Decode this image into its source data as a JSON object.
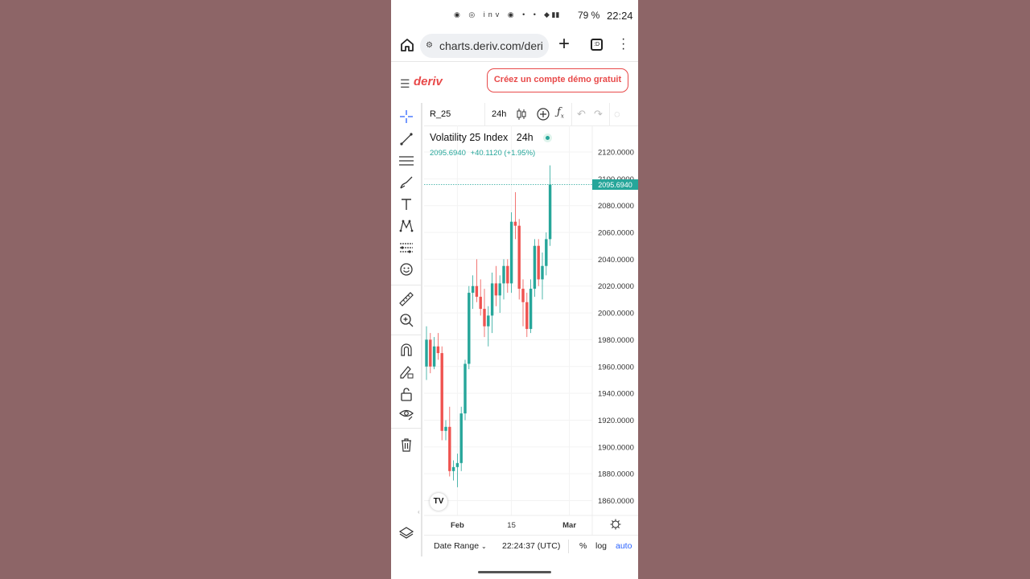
{
  "status_bar": {
    "notification_icons": "◉ ◎ inv ◉ • •",
    "signal": "◆ ▮▮",
    "battery": "79 %",
    "time": "22:24"
  },
  "browser": {
    "url": "charts.deriv.com/deri",
    "tab_count": ":D"
  },
  "app_header": {
    "logo": "deriv",
    "cta_label": "Créez un compte démo gratuit"
  },
  "chart_toolbar": {
    "symbol": "R_25",
    "timeframe": "24h"
  },
  "legend": {
    "title": "Volatility 25 Index",
    "timeframe": "24h",
    "last_price": "2095.6940",
    "change": "+40.1120 (+1.95%)"
  },
  "bottom_bar": {
    "date_range_label": "Date Range",
    "clock": "22:24:37 (UTC)",
    "percent_label": "%",
    "log_label": "log",
    "auto_label": "auto"
  },
  "colors": {
    "up": "#26a69a",
    "down": "#ef5350",
    "brand": "#e84a4a",
    "link": "#2962ff"
  },
  "icons": {
    "left_toolbar": [
      "crosshair-icon",
      "trend-line-icon",
      "horizontal-lines-icon",
      "brush-icon",
      "text-icon",
      "pattern-icon",
      "forecast-icon",
      "emoji-icon",
      "ruler-icon",
      "zoom-in-icon",
      "magnet-icon",
      "lock-drawings-icon",
      "unlock-icon",
      "eye-icon",
      "trash-icon",
      "layers-icon"
    ]
  },
  "chart_data": {
    "type": "candlestick",
    "ylim": [
      1850,
      2130
    ],
    "y_ticks": [
      "2120.0000",
      "2100.0000",
      "2080.0000",
      "2060.0000",
      "2040.0000",
      "2020.0000",
      "2000.0000",
      "1980.0000",
      "1960.0000",
      "1940.0000",
      "1920.0000",
      "1900.0000",
      "1880.0000",
      "1860.0000"
    ],
    "x_ticks": [
      {
        "label": "Feb",
        "index": 8
      },
      {
        "label": "15",
        "index": 22
      },
      {
        "label": "Mar",
        "index": 37
      }
    ],
    "price_line": 2095.694,
    "candles": [
      {
        "o": 1960,
        "h": 1990,
        "l": 1950,
        "c": 1980
      },
      {
        "o": 1980,
        "h": 1985,
        "l": 1955,
        "c": 1960
      },
      {
        "o": 1960,
        "h": 1982,
        "l": 1958,
        "c": 1975
      },
      {
        "o": 1975,
        "h": 1985,
        "l": 1965,
        "c": 1970
      },
      {
        "o": 1970,
        "h": 1975,
        "l": 1905,
        "c": 1912
      },
      {
        "o": 1912,
        "h": 1920,
        "l": 1905,
        "c": 1915
      },
      {
        "o": 1915,
        "h": 1930,
        "l": 1878,
        "c": 1882
      },
      {
        "o": 1882,
        "h": 1890,
        "l": 1875,
        "c": 1885
      },
      {
        "o": 1885,
        "h": 1895,
        "l": 1870,
        "c": 1888
      },
      {
        "o": 1888,
        "h": 1930,
        "l": 1882,
        "c": 1925
      },
      {
        "o": 1925,
        "h": 1965,
        "l": 1920,
        "c": 1962
      },
      {
        "o": 1962,
        "h": 2020,
        "l": 1958,
        "c": 2015
      },
      {
        "o": 2015,
        "h": 2028,
        "l": 2003,
        "c": 2020
      },
      {
        "o": 2020,
        "h": 2040,
        "l": 2008,
        "c": 2012
      },
      {
        "o": 2012,
        "h": 2025,
        "l": 1998,
        "c": 2003
      },
      {
        "o": 2003,
        "h": 2018,
        "l": 1982,
        "c": 1990
      },
      {
        "o": 1990,
        "h": 2005,
        "l": 1975,
        "c": 1998
      },
      {
        "o": 1998,
        "h": 2030,
        "l": 1985,
        "c": 2022
      },
      {
        "o": 2022,
        "h": 2035,
        "l": 2005,
        "c": 2013
      },
      {
        "o": 2013,
        "h": 2028,
        "l": 2000,
        "c": 2022
      },
      {
        "o": 2022,
        "h": 2040,
        "l": 2010,
        "c": 2035
      },
      {
        "o": 2035,
        "h": 2040,
        "l": 2015,
        "c": 2022
      },
      {
        "o": 2022,
        "h": 2075,
        "l": 2015,
        "c": 2068
      },
      {
        "o": 2068,
        "h": 2090,
        "l": 2055,
        "c": 2065
      },
      {
        "o": 2065,
        "h": 2070,
        "l": 2010,
        "c": 2018
      },
      {
        "o": 2018,
        "h": 2025,
        "l": 1990,
        "c": 2008
      },
      {
        "o": 2008,
        "h": 2015,
        "l": 1982,
        "c": 1988
      },
      {
        "o": 1988,
        "h": 2025,
        "l": 1985,
        "c": 2018
      },
      {
        "o": 2018,
        "h": 2055,
        "l": 2012,
        "c": 2050
      },
      {
        "o": 2050,
        "h": 2055,
        "l": 2020,
        "c": 2025
      },
      {
        "o": 2025,
        "h": 2045,
        "l": 2010,
        "c": 2035
      },
      {
        "o": 2035,
        "h": 2060,
        "l": 2028,
        "c": 2055
      },
      {
        "o": 2055,
        "h": 2110,
        "l": 2050,
        "c": 2095.694
      }
    ]
  }
}
